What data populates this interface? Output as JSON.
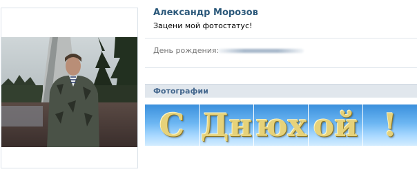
{
  "profile": {
    "name": "Александр Морозов",
    "status": "Зацени мой фотостатус!"
  },
  "info": {
    "birthday_label": "День рождения:"
  },
  "photos": {
    "title": "Фотографии",
    "thumbs": [
      {
        "glyph": "С"
      },
      {
        "glyph": "Дн"
      },
      {
        "glyph": "юх"
      },
      {
        "glyph": "ой"
      },
      {
        "glyph": "!"
      }
    ]
  },
  "colors": {
    "name_link": "#2b587a",
    "section_header_bg": "#e1e7ed",
    "section_title": "#45688e",
    "label_gray": "#777777"
  }
}
